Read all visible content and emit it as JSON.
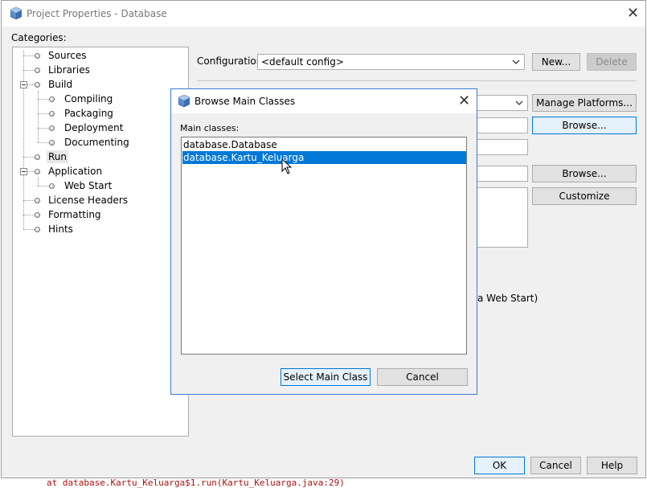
{
  "window": {
    "title": "Project Properties - Database",
    "close_glyph": "✕"
  },
  "categories_label": "Categories:",
  "tree": {
    "sources": "Sources",
    "libraries": "Libraries",
    "build": "Build",
    "compiling": "Compiling",
    "packaging": "Packaging",
    "deployment": "Deployment",
    "documenting": "Documenting",
    "run": "Run",
    "application": "Application",
    "web_start": "Web Start",
    "license_headers": "License Headers",
    "formatting": "Formatting",
    "hints": "Hints"
  },
  "config": {
    "label": "Configuration:",
    "value": "<default config>",
    "new_label": "New...",
    "delete_label": "Delete"
  },
  "run_panel": {
    "manage_platforms_label": "Manage Platforms...",
    "browse_label": "Browse...",
    "browse2_label": "Browse...",
    "customize_label": "Customize",
    "partial_text": "a Web Start)"
  },
  "dialog": {
    "title": "Browse Main Classes",
    "close_glyph": "✕",
    "list_label": "Main classes:",
    "classes": [
      "database.Database",
      "database.Kartu_Keluarga"
    ],
    "selected_class": "database.Kartu_Keluarga",
    "select_label": "Select Main Class",
    "cancel_label": "Cancel"
  },
  "footer": {
    "ok_label": "OK",
    "cancel_label": "Cancel",
    "help_label": "Help"
  },
  "background": {
    "console_text": "at database.Kartu_Keluarga$1.run(Kartu_Keluarga.java:29)"
  },
  "colors": {
    "accent": "#0078d7",
    "selection": "#0078d7",
    "dialog_border": "#3a7bd5"
  }
}
